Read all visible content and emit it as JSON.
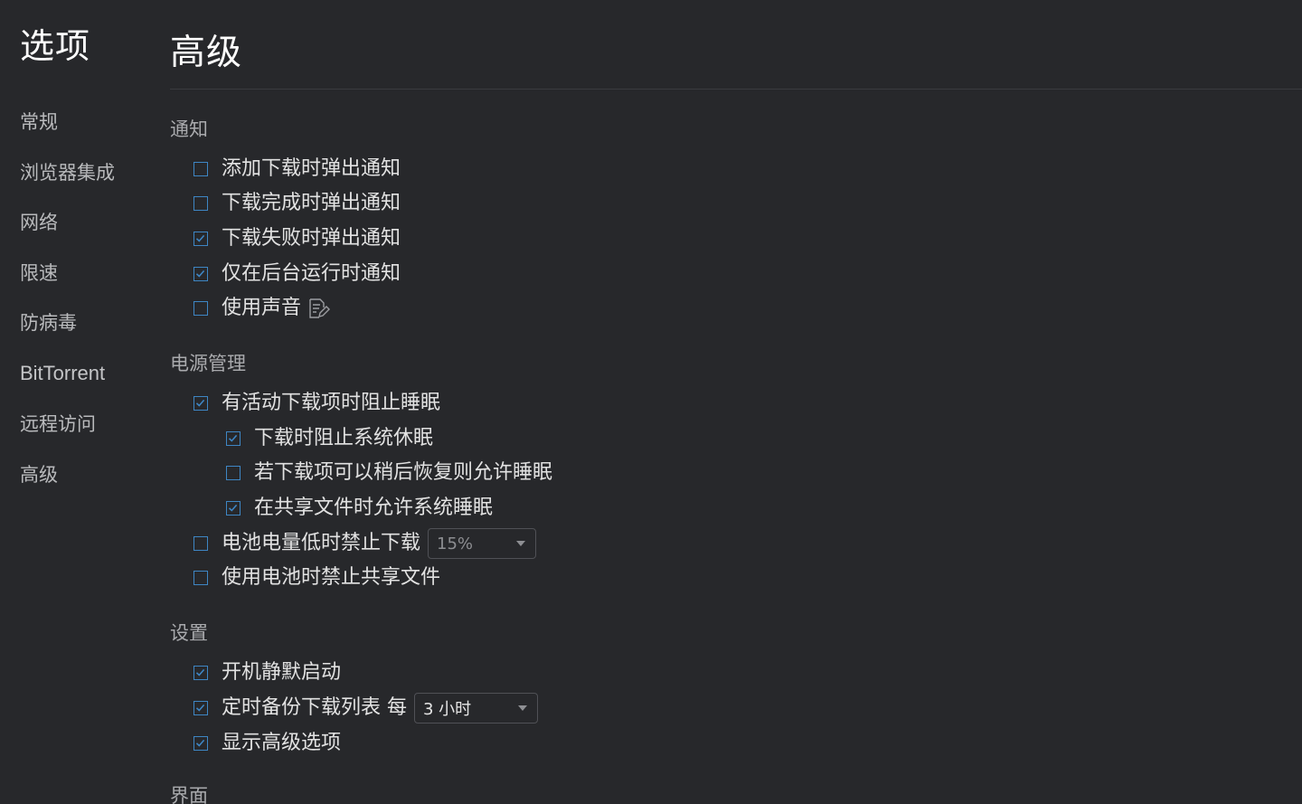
{
  "sidebar": {
    "title": "选项",
    "items": [
      {
        "label": "常规"
      },
      {
        "label": "浏览器集成"
      },
      {
        "label": "网络"
      },
      {
        "label": "限速"
      },
      {
        "label": "防病毒"
      },
      {
        "label": "BitTorrent"
      },
      {
        "label": "远程访问"
      },
      {
        "label": "高级"
      }
    ]
  },
  "page": {
    "title": "高级"
  },
  "sections": {
    "notifications": {
      "header": "通知",
      "options": [
        {
          "label": "添加下载时弹出通知",
          "checked": false
        },
        {
          "label": "下载完成时弹出通知",
          "checked": false
        },
        {
          "label": "下载失败时弹出通知",
          "checked": true
        },
        {
          "label": "仅在后台运行时通知",
          "checked": true
        },
        {
          "label": "使用声音",
          "checked": false
        }
      ]
    },
    "power": {
      "header": "电源管理",
      "options": [
        {
          "label": "有活动下载项时阻止睡眠",
          "checked": true
        },
        {
          "label": "下载时阻止系统休眠",
          "checked": true
        },
        {
          "label": "若下载项可以稍后恢复则允许睡眠",
          "checked": false
        },
        {
          "label": "在共享文件时允许系统睡眠",
          "checked": true
        },
        {
          "label": "电池电量低时禁止下载",
          "checked": false
        },
        {
          "label": "使用电池时禁止共享文件",
          "checked": false
        }
      ],
      "battery_select": {
        "value": "15%"
      }
    },
    "settings": {
      "header": "设置",
      "options": [
        {
          "label": "开机静默启动",
          "checked": true
        },
        {
          "label": "定时备份下载列表 每",
          "checked": true
        },
        {
          "label": "显示高级选项",
          "checked": true
        }
      ],
      "backup_select": {
        "value": "3 小时"
      }
    },
    "interface": {
      "header": "界面"
    }
  },
  "colors": {
    "background": "#27282b",
    "checkbox_border": "#3e86c4",
    "text": "#e2e2e2"
  }
}
